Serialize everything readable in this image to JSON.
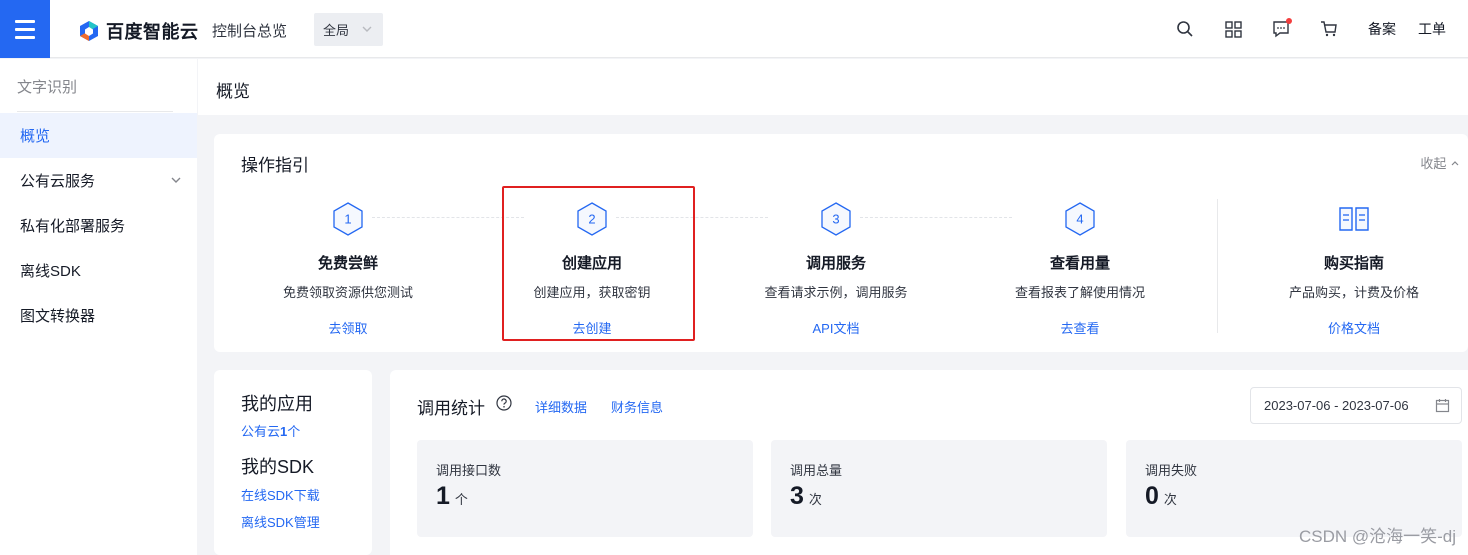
{
  "header": {
    "brand": "百度智能云",
    "console_title": "控制台总览",
    "region": "全局",
    "links": [
      "备案",
      "工单"
    ],
    "accent": "#2468f2",
    "icons": [
      "search-icon",
      "grid-icon",
      "message-icon",
      "cart-icon"
    ]
  },
  "sidebar": {
    "title": "文字识别",
    "items": [
      {
        "label": "概览",
        "active": true
      },
      {
        "label": "公有云服务",
        "expandable": true
      },
      {
        "label": "私有化部署服务"
      },
      {
        "label": "离线SDK"
      },
      {
        "label": "图文转换器"
      }
    ]
  },
  "page": {
    "title": "概览"
  },
  "guide": {
    "title": "操作指引",
    "collapse_label": "收起",
    "steps": [
      {
        "num": "1",
        "name": "免费尝鲜",
        "desc": "免费领取资源供您测试",
        "link": "去领取"
      },
      {
        "num": "2",
        "name": "创建应用",
        "desc": "创建应用，获取密钥",
        "link": "去创建"
      },
      {
        "num": "3",
        "name": "调用服务",
        "desc": "查看请求示例，调用服务",
        "link": "API文档"
      },
      {
        "num": "4",
        "name": "查看用量",
        "desc": "查看报表了解使用情况",
        "link": "去查看"
      }
    ],
    "purchase": {
      "name": "购买指南",
      "desc": "产品购买，计费及价格",
      "link": "价格文档"
    }
  },
  "apps": {
    "my_apps": "我的应用",
    "public_prefix": "公有云",
    "public_count": "1",
    "public_suffix": "个",
    "my_sdk": "我的SDK",
    "sdk_links": [
      "在线SDK下载",
      "离线SDK管理"
    ]
  },
  "stats": {
    "title": "调用统计",
    "tabs": [
      "详细数据",
      "财务信息"
    ],
    "date_range": "2023-07-06 - 2023-07-06",
    "cards": [
      {
        "label": "调用接口数",
        "value": "1",
        "unit": "个"
      },
      {
        "label": "调用总量",
        "value": "3",
        "unit": "次"
      },
      {
        "label": "调用失败",
        "value": "0",
        "unit": "次"
      }
    ]
  },
  "watermark": "CSDN @沧海一笑-dj"
}
